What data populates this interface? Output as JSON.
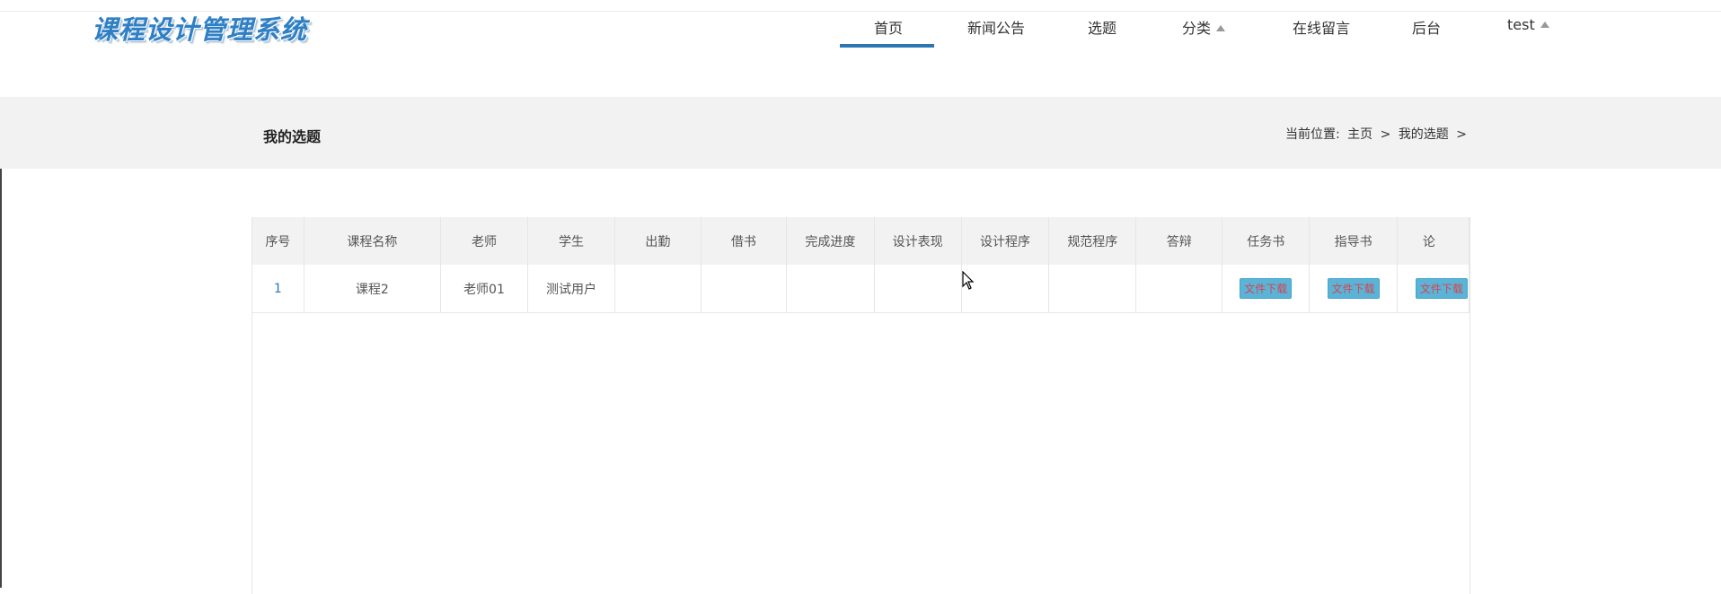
{
  "header": {
    "logo_text": "课程设计管理系统",
    "nav": [
      {
        "label": "首页",
        "active": true
      },
      {
        "label": "新闻公告"
      },
      {
        "label": "选题"
      },
      {
        "label": "分类",
        "has_dropdown": true
      },
      {
        "label": "在线留言"
      },
      {
        "label": "后台"
      },
      {
        "label": "test",
        "has_dropdown": true
      }
    ],
    "accent_color": "#2b77b1"
  },
  "subheader": {
    "title": "我的选题",
    "breadcrumb_prefix": "当前位置:",
    "breadcrumb": [
      "主页",
      ">",
      "我的选题",
      ">"
    ]
  },
  "table": {
    "columns": [
      "序号",
      "课程名称",
      "老师",
      "学生",
      "出勤",
      "借书",
      "完成进度",
      "设计表现",
      "设计程序",
      "规范程序",
      "答辩",
      "任务书",
      "指导书",
      "论"
    ],
    "rows": [
      {
        "index": "1",
        "course": "课程2",
        "teacher": "老师01",
        "student": "测试用户",
        "attendance": "",
        "borrow": "",
        "progress": "",
        "performance": "",
        "program": "",
        "standard": "",
        "defense": "",
        "task_btn": "文件下载",
        "guide_btn": "文件下载",
        "paper_btn": "文件下载"
      }
    ]
  }
}
